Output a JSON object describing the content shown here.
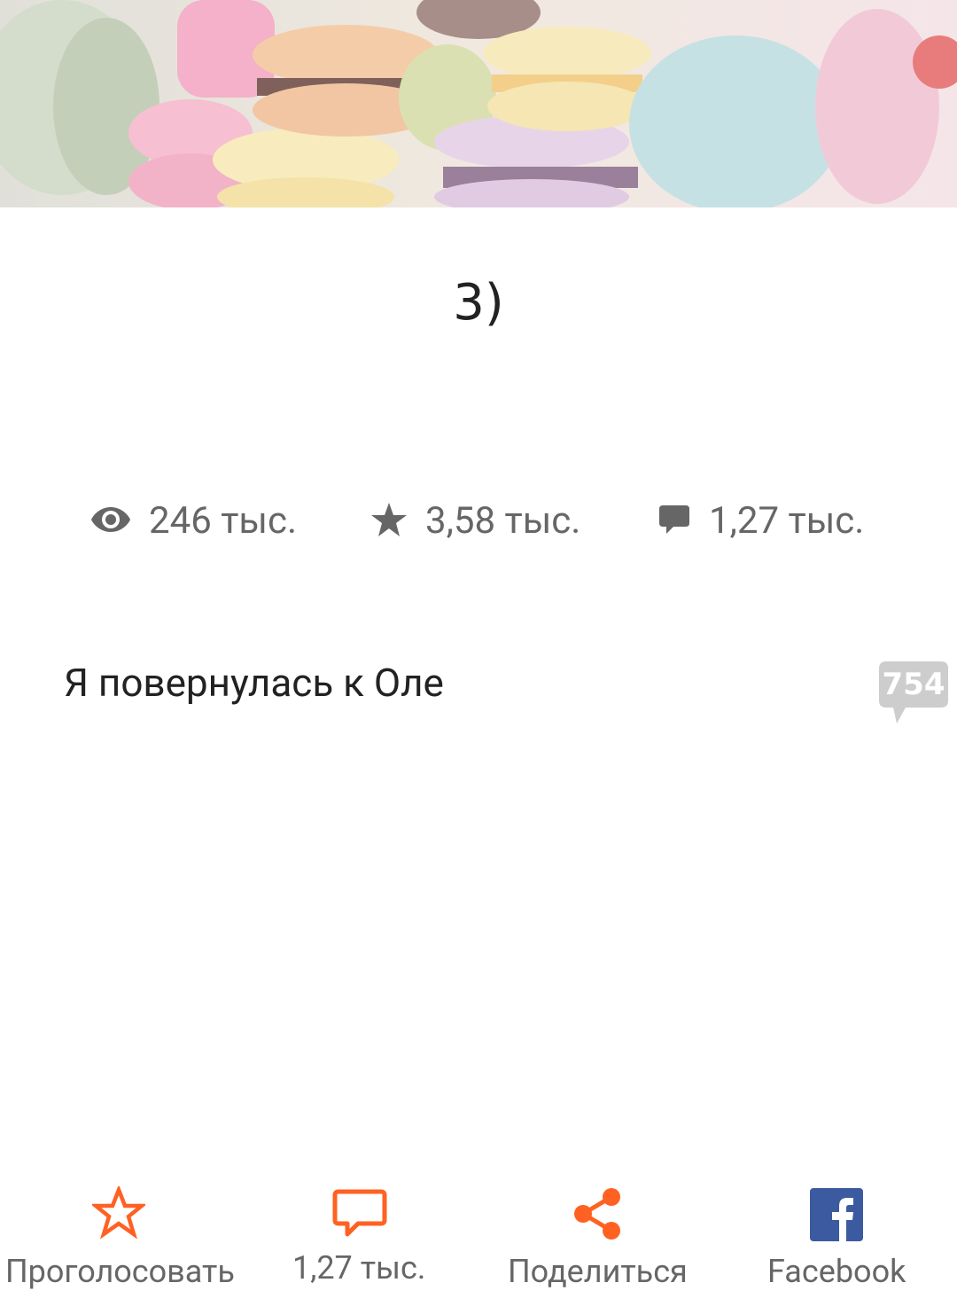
{
  "header": {
    "image": "macarons-photo"
  },
  "part": {
    "title": "3)"
  },
  "stats": {
    "views": {
      "icon": "eye-icon",
      "label": "246 тыс."
    },
    "votes": {
      "icon": "star-icon",
      "label": "3,58 тыс."
    },
    "comments": {
      "icon": "speech-bubble-icon",
      "label": "1,27 тыс."
    }
  },
  "story": {
    "paragraphs": [
      {
        "text": "Я повернулась к Оле",
        "comment_count": "754"
      }
    ]
  },
  "bottom_bar": {
    "accent_color": "#ff6122",
    "items": [
      {
        "icon": "star-outline-icon",
        "label": "Проголосовать"
      },
      {
        "icon": "comment-icon",
        "label": "1,27 тыс."
      },
      {
        "icon": "share-icon",
        "label": "Поделиться"
      },
      {
        "icon": "facebook-icon",
        "label": "Facebook"
      }
    ]
  }
}
